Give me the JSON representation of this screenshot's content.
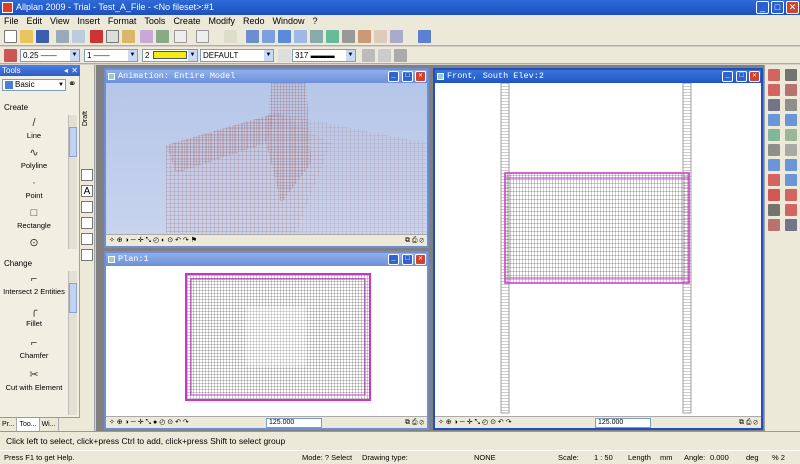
{
  "window": {
    "title": "Allplan 2009 - Trial - Test_A_File - <No fileset>:#1"
  },
  "menu": [
    "File",
    "Edit",
    "View",
    "Insert",
    "Format",
    "Tools",
    "Create",
    "Modify",
    "Redo",
    "Window",
    "?"
  ],
  "format_bar": {
    "pen": "0.25",
    "line": "1",
    "color_number": "2",
    "color_swatch": "#f2ec14",
    "layer": "DEFAULT",
    "fill_number": "317"
  },
  "palette": {
    "title": "Tools",
    "selector": "Basic",
    "draft_label": "Draft",
    "sections": {
      "create": "Create",
      "change": "Change"
    },
    "create_tools": [
      {
        "label": "Line",
        "icon": "line-icon",
        "glyph": "/"
      },
      {
        "label": "Polyline",
        "icon": "polyline-icon",
        "glyph": "∿"
      },
      {
        "label": "Point",
        "icon": "point-icon",
        "glyph": "·"
      },
      {
        "label": "Rectangle",
        "icon": "rectangle-icon",
        "glyph": "□"
      },
      {
        "label": "",
        "icon": "circle-icon",
        "glyph": "⊙"
      }
    ],
    "change_tools": [
      {
        "label": "Intersect 2 Entities",
        "icon": "intersect-icon",
        "glyph": "⌐"
      },
      {
        "label": "Fillet",
        "icon": "fillet-icon",
        "glyph": "╭"
      },
      {
        "label": "Chamfer",
        "icon": "chamfer-icon",
        "glyph": "⌐"
      },
      {
        "label": "Cut with Element",
        "icon": "cut-icon",
        "glyph": "✂"
      }
    ],
    "tabs": [
      "Pr...",
      "Too...",
      "Wi..."
    ]
  },
  "windows": {
    "animation": {
      "title": "Animation: Entire Model"
    },
    "front": {
      "title": "Front, South Elev:2",
      "zoom": "125.000"
    },
    "plan": {
      "title": "Plan:1",
      "zoom": "125.000"
    }
  },
  "hint": "Click left to select, click+press Ctrl to add, click+press Shift to select group",
  "status": {
    "help": "Press F1 to get Help.",
    "mode": "Mode: ? Select",
    "drawing_type_label": "Drawing type:",
    "drawing_type_value": "NONE",
    "scale_label": "Scale:",
    "scale_value": "1 : 50",
    "length_label": "Length",
    "length_unit": "mm",
    "angle_label": "Angle:",
    "angle_value": "0.000",
    "angle_unit": "deg",
    "extra": "% 2"
  },
  "colors": {
    "accent": "#2d5bc4",
    "mesh": "#c46b6b",
    "outline": "#cc33cc"
  }
}
